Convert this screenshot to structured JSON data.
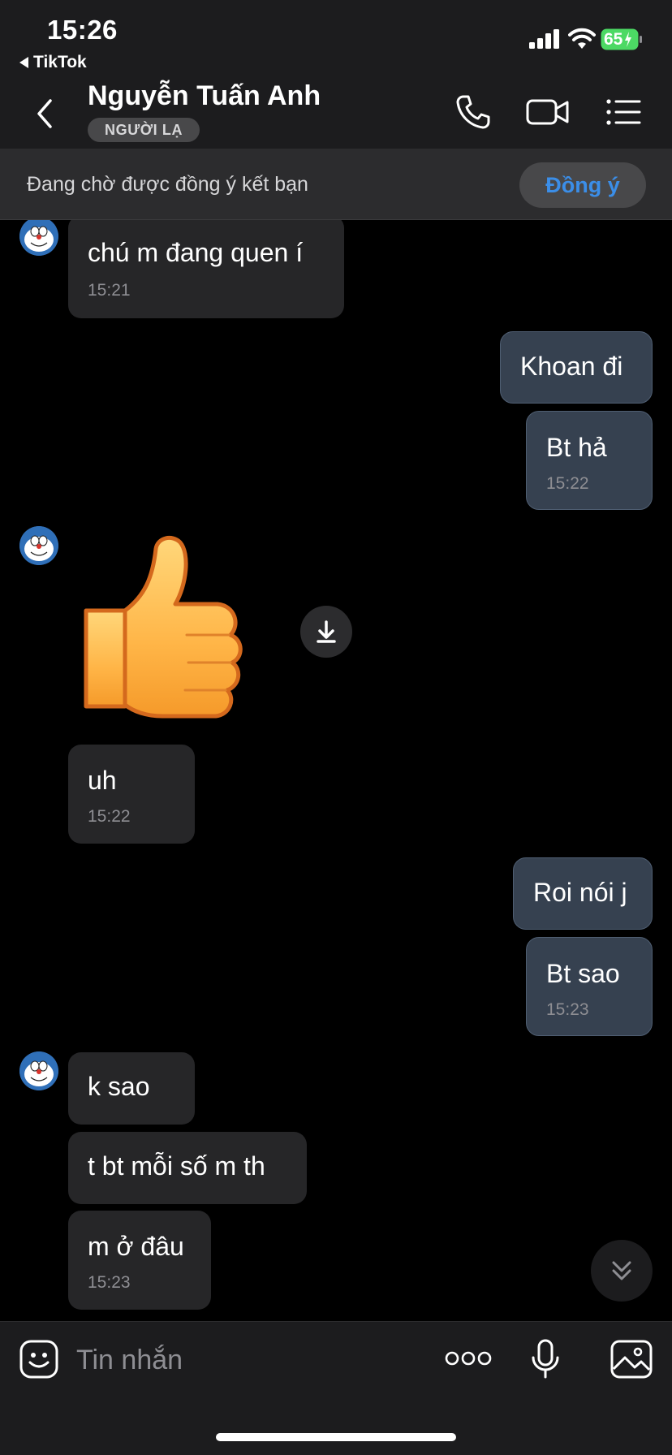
{
  "status_bar": {
    "time": "15:26",
    "back_app": "TikTok",
    "battery": "65"
  },
  "header": {
    "contact_name": "Nguyễn Tuấn Anh",
    "badge": "NGƯỜI LẠ"
  },
  "banner": {
    "text": "Đang chờ được đồng ý kết bạn",
    "accept_label": "Đồng ý"
  },
  "messages": [
    {
      "dir": "in",
      "text": "chú m đang quen í",
      "time": "15:21"
    },
    {
      "dir": "out",
      "text": "Khoan đi"
    },
    {
      "dir": "out",
      "text": "Bt hả",
      "time": "15:22"
    },
    {
      "dir": "in",
      "sticker": "thumbs-up"
    },
    {
      "dir": "in",
      "text": "uh",
      "time": "15:22"
    },
    {
      "dir": "out",
      "text": "Roi nói j"
    },
    {
      "dir": "out",
      "text": "Bt sao",
      "time": "15:23"
    },
    {
      "dir": "in",
      "text": "k sao"
    },
    {
      "dir": "in",
      "text": "t bt mỗi số m th"
    },
    {
      "dir": "in",
      "text": "m ở đâu",
      "time": "15:23"
    }
  ],
  "input": {
    "placeholder": "Tin nhắn"
  },
  "colors": {
    "accent": "#3b8ee8",
    "bubble_in": "#262628",
    "bubble_out": "#364150",
    "battery_green": "#4cd964"
  }
}
